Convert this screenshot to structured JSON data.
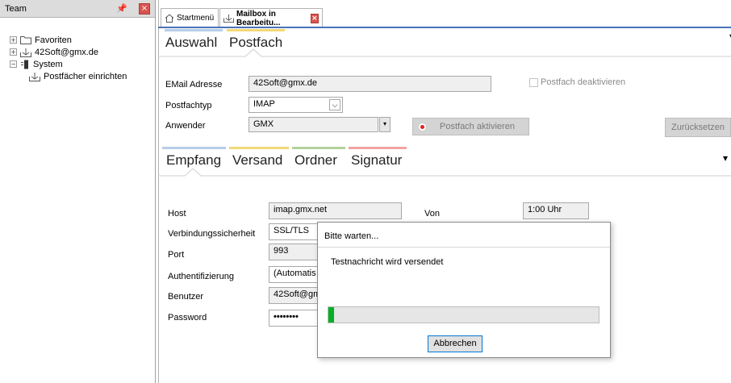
{
  "team_panel": {
    "title": "Team",
    "tree": [
      {
        "label": "Favoriten",
        "expander": "+"
      },
      {
        "label": "42Soft@gmx.de",
        "expander": "+"
      },
      {
        "label": "System",
        "expander": "−"
      },
      {
        "label": "Postfächer einrichten",
        "expander": ""
      }
    ]
  },
  "tabs": {
    "startmenu": "Startmenü",
    "mailbox": "Mailbox in Bearbeitu..."
  },
  "top_pivot": {
    "items": [
      "Auswahl",
      "Postfach"
    ],
    "colors": {
      "Auswahl": "#b7cdea",
      "Postfach": "#f3d877"
    }
  },
  "postfach": {
    "email_label": "EMail Adresse",
    "email_value": "42Soft@gmx.de",
    "deactivate_label": "Postfach deaktivieren",
    "type_label": "Postfachtyp",
    "type_value": "IMAP",
    "user_label": "Anwender",
    "user_value": "GMX",
    "activate_label": "Postfach aktivieren",
    "reset_label": "Zurücksetzen"
  },
  "sub_pivot": {
    "items": [
      "Empfang",
      "Versand",
      "Ordner",
      "Signatur"
    ],
    "colors": [
      "#b7cdea",
      "#f3d877",
      "#b3d19c",
      "#f1a3a3"
    ]
  },
  "empfang": {
    "host_label": "Host",
    "host_value": "imap.gmx.net",
    "von_label": "Von",
    "von_value": "1:00 Uhr",
    "security_label": "Verbindungssicherheit",
    "security_value": "SSL/TLS",
    "port_label": "Port",
    "port_value": "993",
    "auth_label": "Authentifizierung",
    "auth_value": "(Automatis",
    "benutzer_label": "Benutzer",
    "benutzer_value": "42Soft@gm",
    "password_label": "Password",
    "password_value": "••••••••"
  },
  "dialog": {
    "title": "Bitte warten...",
    "message": "Testnachricht wird versendet",
    "progress": 0.02,
    "progress_color": "#06b025",
    "cancel_label": "Abbrechen"
  }
}
